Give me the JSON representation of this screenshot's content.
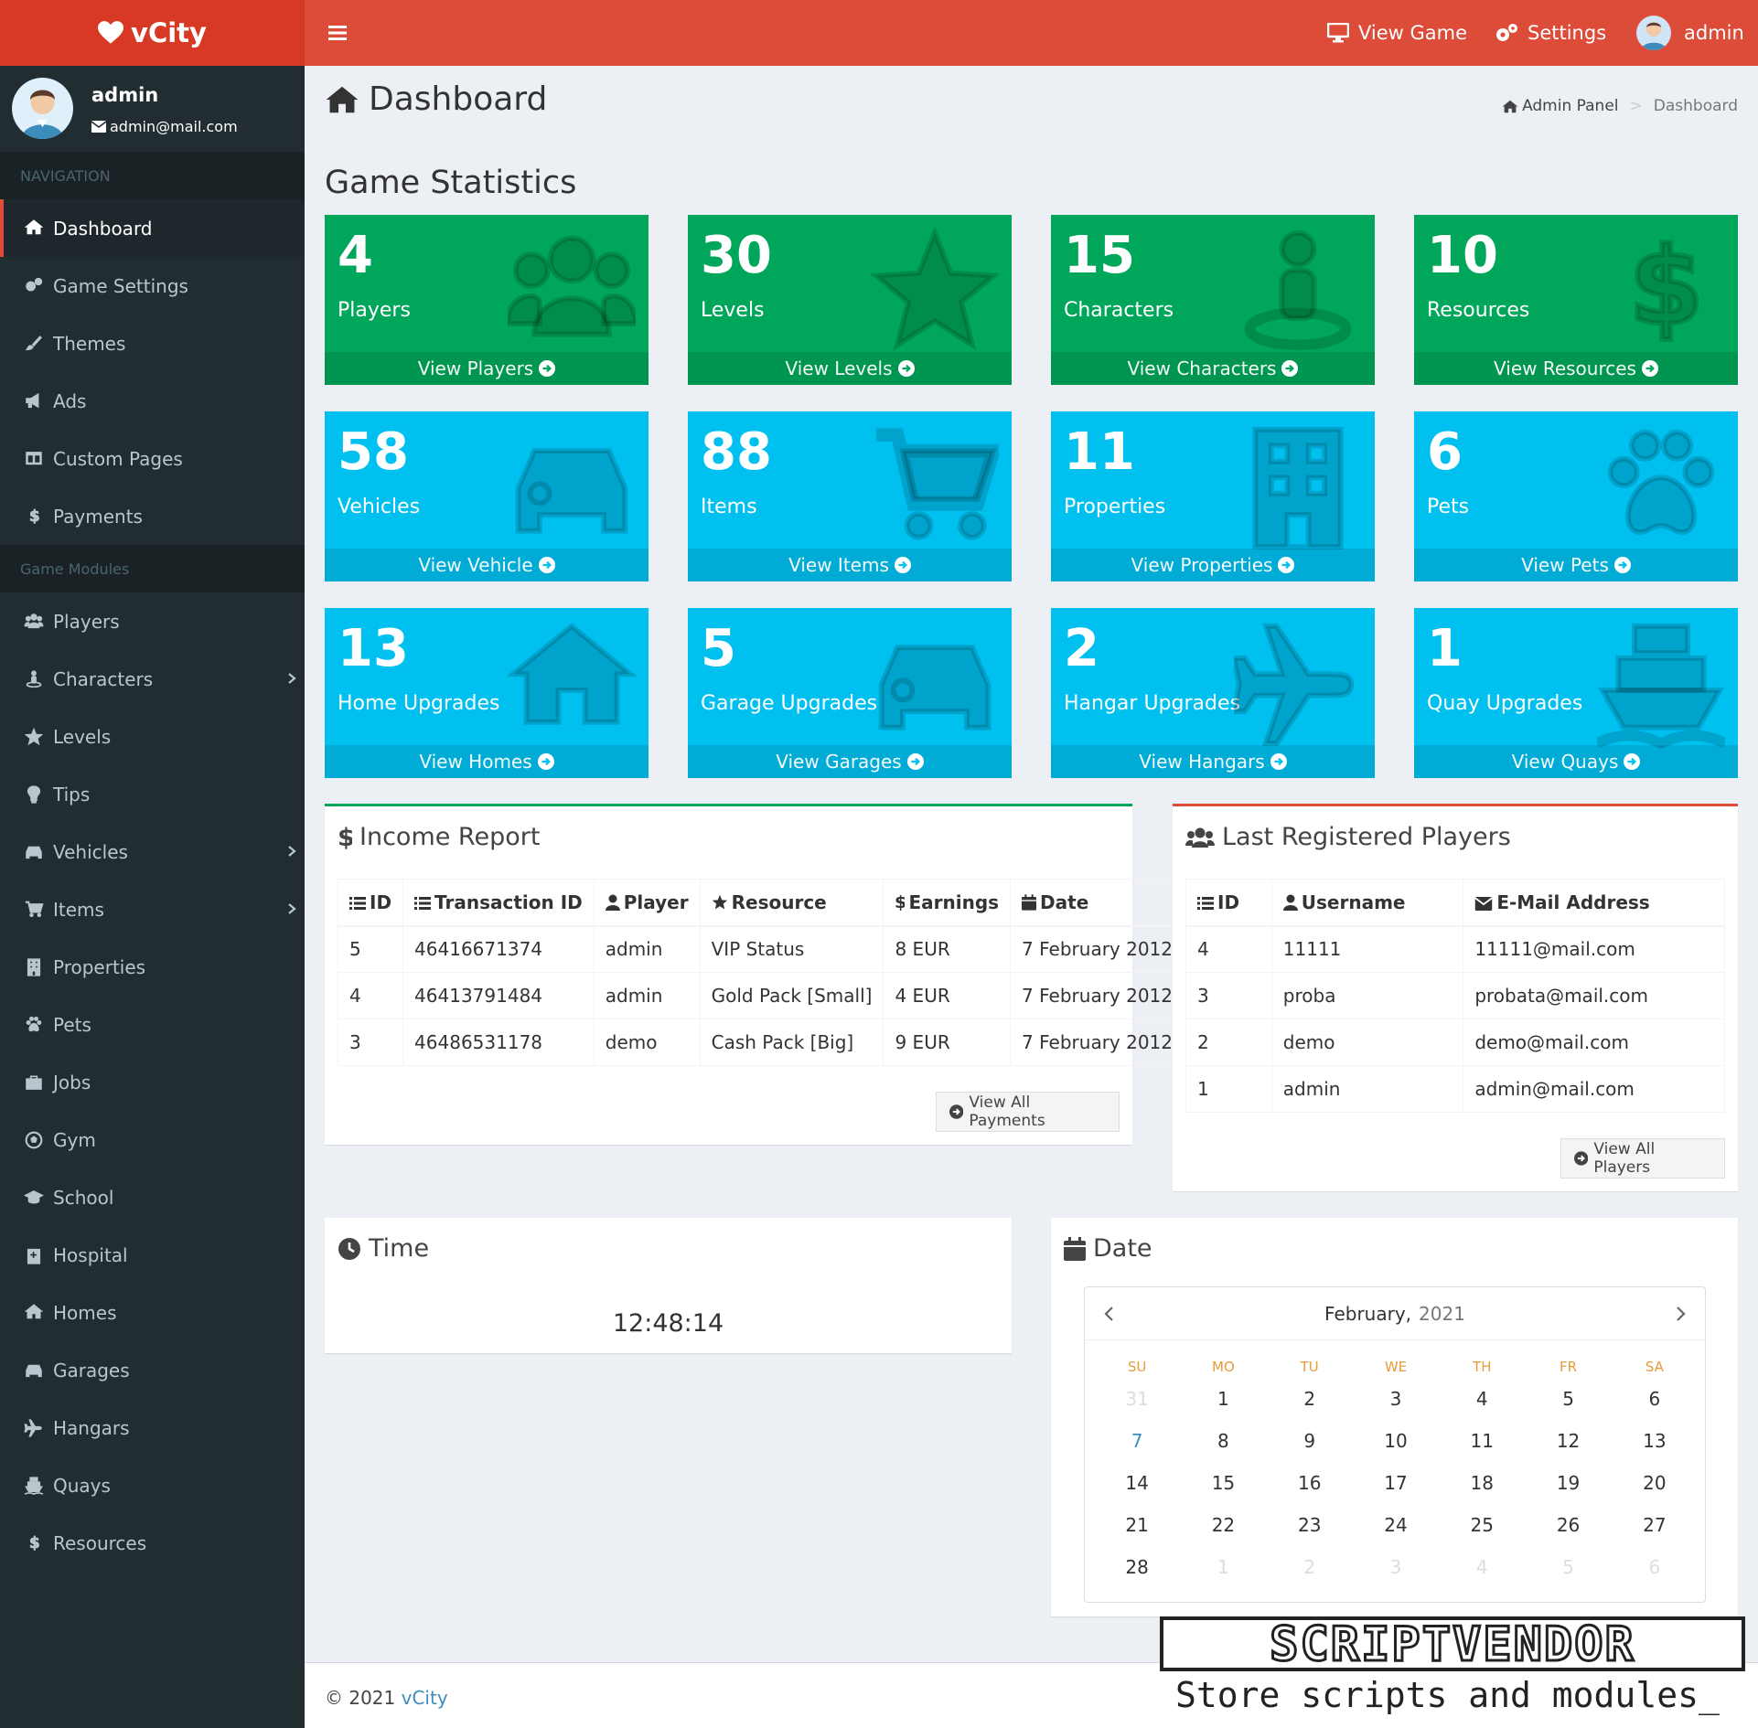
{
  "app": {
    "name": "vCity"
  },
  "topnav": {
    "view_game": "View Game",
    "settings": "Settings",
    "user": "admin"
  },
  "user": {
    "name": "admin",
    "email": "admin@mail.com"
  },
  "sidebar": {
    "header_navigation": "NAVIGATION",
    "header_modules": "Game Modules",
    "nav_items": [
      {
        "label": "Dashboard",
        "icon": "home-icon",
        "active": true
      },
      {
        "label": "Game Settings",
        "icon": "cogs-icon"
      },
      {
        "label": "Themes",
        "icon": "paintbrush-icon"
      },
      {
        "label": "Ads",
        "icon": "bullhorn-icon"
      },
      {
        "label": "Custom Pages",
        "icon": "columns-icon"
      },
      {
        "label": "Payments",
        "icon": "dollar-icon"
      }
    ],
    "module_items": [
      {
        "label": "Players",
        "icon": "users-icon"
      },
      {
        "label": "Characters",
        "icon": "street-view-icon",
        "has_children": true
      },
      {
        "label": "Levels",
        "icon": "star-icon"
      },
      {
        "label": "Tips",
        "icon": "lightbulb-icon"
      },
      {
        "label": "Vehicles",
        "icon": "car-icon",
        "has_children": true
      },
      {
        "label": "Items",
        "icon": "cart-icon",
        "has_children": true
      },
      {
        "label": "Properties",
        "icon": "building-icon"
      },
      {
        "label": "Pets",
        "icon": "paw-icon"
      },
      {
        "label": "Jobs",
        "icon": "briefcase-icon"
      },
      {
        "label": "Gym",
        "icon": "futbol-icon"
      },
      {
        "label": "School",
        "icon": "graduation-cap-icon"
      },
      {
        "label": "Hospital",
        "icon": "hospital-icon"
      },
      {
        "label": "Homes",
        "icon": "home-icon"
      },
      {
        "label": "Garages",
        "icon": "car-icon"
      },
      {
        "label": "Hangars",
        "icon": "plane-icon"
      },
      {
        "label": "Quays",
        "icon": "ship-icon"
      },
      {
        "label": "Resources",
        "icon": "dollar-icon"
      }
    ]
  },
  "page": {
    "title": "Dashboard",
    "breadcrumb": [
      "Admin Panel",
      "Dashboard"
    ],
    "section_title": "Game Statistics"
  },
  "stats": [
    {
      "value": "4",
      "label": "Players",
      "link": "View Players",
      "color": "green",
      "icon": "users-icon"
    },
    {
      "value": "30",
      "label": "Levels",
      "link": "View Levels",
      "color": "green",
      "icon": "star-icon"
    },
    {
      "value": "15",
      "label": "Characters",
      "link": "View Characters",
      "color": "green",
      "icon": "street-view-icon"
    },
    {
      "value": "10",
      "label": "Resources",
      "link": "View Resources",
      "color": "green",
      "icon": "dollar-icon"
    },
    {
      "value": "58",
      "label": "Vehicles",
      "link": "View Vehicle",
      "color": "aqua",
      "icon": "car-icon"
    },
    {
      "value": "88",
      "label": "Items",
      "link": "View Items",
      "color": "aqua",
      "icon": "cart-icon"
    },
    {
      "value": "11",
      "label": "Properties",
      "link": "View Properties",
      "color": "aqua",
      "icon": "building-icon"
    },
    {
      "value": "6",
      "label": "Pets",
      "link": "View Pets",
      "color": "aqua",
      "icon": "paw-icon"
    },
    {
      "value": "13",
      "label": "Home Upgrades",
      "link": "View Homes",
      "color": "aqua",
      "icon": "home-icon"
    },
    {
      "value": "5",
      "label": "Garage Upgrades",
      "link": "View Garages",
      "color": "aqua",
      "icon": "car-icon"
    },
    {
      "value": "2",
      "label": "Hangar Upgrades",
      "link": "View Hangars",
      "color": "aqua",
      "icon": "plane-icon"
    },
    {
      "value": "1",
      "label": "Quay Upgrades",
      "link": "View Quays",
      "color": "aqua",
      "icon": "ship-icon"
    }
  ],
  "income": {
    "title": "Income Report",
    "columns": [
      "ID",
      "Transaction ID",
      "Player",
      "Resource",
      "Earnings",
      "Date"
    ],
    "rows": [
      [
        "5",
        "46416671374",
        "admin",
        "VIP Status",
        "8 EUR",
        "7 February 2012"
      ],
      [
        "4",
        "46413791484",
        "admin",
        "Gold Pack [Small]",
        "4 EUR",
        "7 February 2012"
      ],
      [
        "3",
        "46486531178",
        "demo",
        "Cash Pack [Big]",
        "9 EUR",
        "7 February 2012"
      ]
    ],
    "button": "View All Payments",
    "accent": "#00a65a"
  },
  "players": {
    "title": "Last Registered Players",
    "columns": [
      "ID",
      "Username",
      "E-Mail Address"
    ],
    "rows": [
      [
        "4",
        "11111",
        "11111@mail.com"
      ],
      [
        "3",
        "proba",
        "probata@mail.com"
      ],
      [
        "2",
        "demo",
        "demo@mail.com"
      ],
      [
        "1",
        "admin",
        "admin@mail.com"
      ]
    ],
    "button": "View All Players",
    "accent": "#dd4b39"
  },
  "time": {
    "title": "Time",
    "value": "12:48:14"
  },
  "date": {
    "title": "Date",
    "month": "February,",
    "year": "2021",
    "weekdays": [
      "SU",
      "MO",
      "TU",
      "WE",
      "TH",
      "FR",
      "SA"
    ],
    "days": [
      [
        "31",
        "1",
        "2",
        "3",
        "4",
        "5",
        "6"
      ],
      [
        "7",
        "8",
        "9",
        "10",
        "11",
        "12",
        "13"
      ],
      [
        "14",
        "15",
        "16",
        "17",
        "18",
        "19",
        "20"
      ],
      [
        "21",
        "22",
        "23",
        "24",
        "25",
        "26",
        "27"
      ],
      [
        "28",
        "1",
        "2",
        "3",
        "4",
        "5",
        "6"
      ]
    ]
  },
  "footer": {
    "copyright": "© 2021",
    "link": "vCity"
  },
  "watermark": {
    "name": "SCRIPTVENDOR",
    "tagline": "Store scripts and modules_"
  }
}
